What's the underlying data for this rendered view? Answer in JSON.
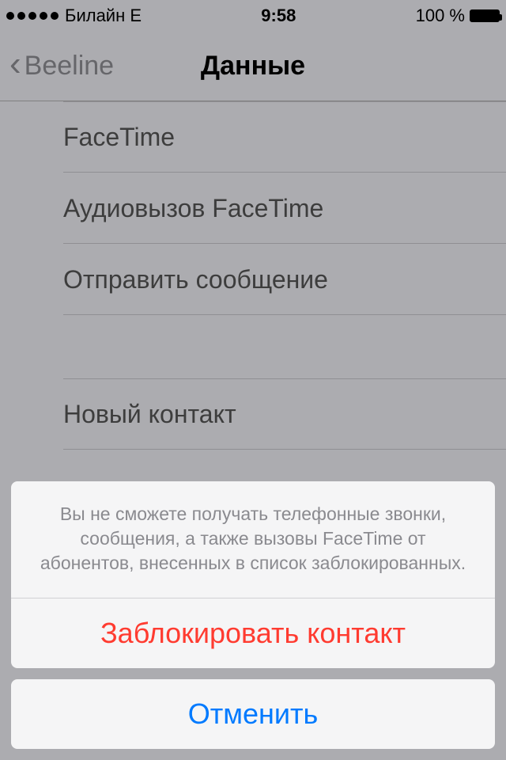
{
  "status": {
    "carrier": "Билайн  E",
    "time": "9:58",
    "battery_pct": "100 %"
  },
  "nav": {
    "back_label": "Beeline",
    "title": "Данные"
  },
  "rows": {
    "facetime": "FaceTime",
    "facetime_audio": "Аудиовызов FaceTime",
    "send_message": "Отправить сообщение",
    "new_contact": "Новый контакт"
  },
  "sheet": {
    "message": "Вы не сможете получать телефонные звонки, сообщения, а также вызовы FaceTime от абонентов, внесенных в список заблокированных.",
    "block_label": "Заблокировать контакт",
    "cancel_label": "Отменить"
  }
}
